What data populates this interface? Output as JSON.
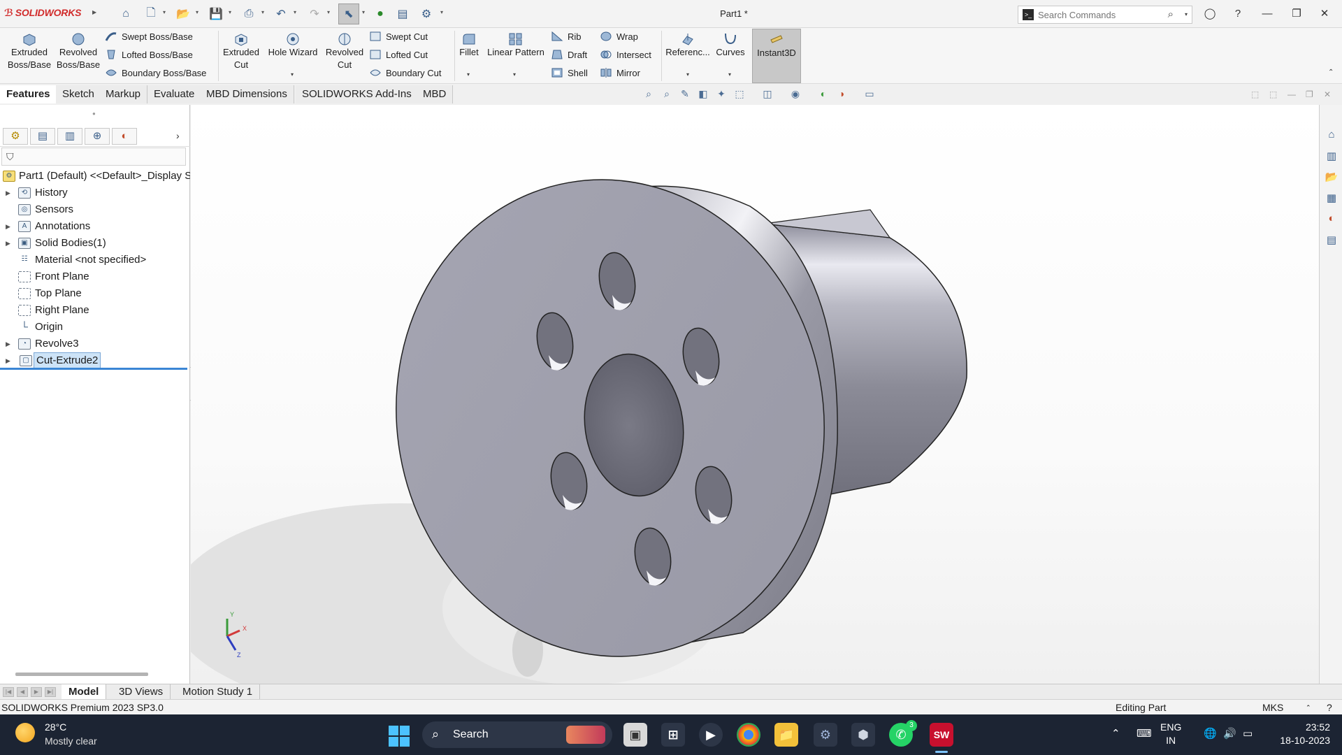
{
  "app": {
    "logo": "SOLIDWORKS",
    "document_title": "Part1 *",
    "search_placeholder": "Search Commands"
  },
  "ribbon": {
    "extruded_boss": "Extruded\nBoss/Base",
    "revolved_boss": "Revolved\nBoss/Base",
    "swept_boss": "Swept Boss/Base",
    "lofted_boss": "Lofted Boss/Base",
    "boundary_boss": "Boundary Boss/Base",
    "extruded_cut": "Extruded\nCut",
    "hole_wizard": "Hole Wizard",
    "revolved_cut": "Revolved\nCut",
    "swept_cut": "Swept Cut",
    "lofted_cut": "Lofted Cut",
    "boundary_cut": "Boundary Cut",
    "fillet": "Fillet",
    "linear_pattern": "Linear Pattern",
    "rib": "Rib",
    "draft": "Draft",
    "shell": "Shell",
    "wrap": "Wrap",
    "intersect": "Intersect",
    "mirror": "Mirror",
    "reference": "Referenc...",
    "curves": "Curves",
    "instant3d": "Instant3D"
  },
  "tabs": [
    "Features",
    "Sketch",
    "Markup",
    "Evaluate",
    "MBD Dimensions",
    "SOLIDWORKS Add-Ins",
    "MBD"
  ],
  "tree": {
    "root": "Part1 (Default) <<Default>_Display S",
    "items": [
      {
        "label": "History",
        "icon": "history-icon"
      },
      {
        "label": "Sensors",
        "icon": "sensors-icon"
      },
      {
        "label": "Annotations",
        "icon": "annotations-icon"
      },
      {
        "label": "Solid Bodies(1)",
        "icon": "solid-bodies-icon"
      },
      {
        "label": "Material <not specified>",
        "icon": "material-icon"
      },
      {
        "label": "Front Plane",
        "icon": "plane-icon"
      },
      {
        "label": "Top Plane",
        "icon": "plane-icon"
      },
      {
        "label": "Right Plane",
        "icon": "plane-icon"
      },
      {
        "label": "Origin",
        "icon": "origin-icon"
      },
      {
        "label": "Revolve3",
        "icon": "revolve-icon"
      },
      {
        "label": "Cut-Extrude2",
        "icon": "cut-extrude-icon"
      }
    ]
  },
  "bottom_tabs": [
    "Model",
    "3D Views",
    "Motion Study 1"
  ],
  "status": {
    "version": "SOLIDWORKS Premium 2023 SP3.0",
    "mode": "Editing Part",
    "units": "MKS"
  },
  "taskbar": {
    "temperature": "28°C",
    "weather": "Mostly clear",
    "search": "Search",
    "lang_top": "ENG",
    "lang_bottom": "IN",
    "time": "23:52",
    "date": "18-10-2023",
    "whatsapp_badge": "3"
  },
  "colors": {
    "brand_red": "#d12b2b",
    "selection_blue": "#3b86d5",
    "taskbar_bg": "#1c2433"
  }
}
